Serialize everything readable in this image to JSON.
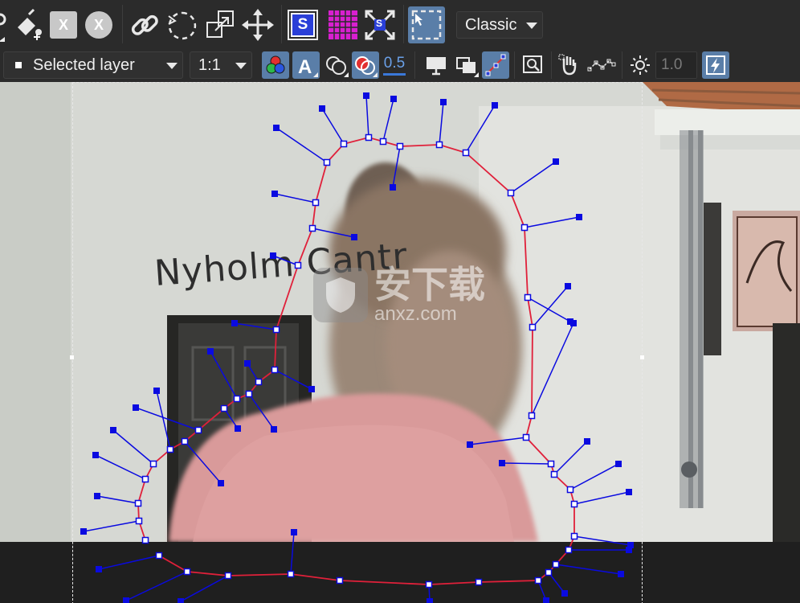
{
  "toolbar1": {
    "mode_dropdown": {
      "value": "Classic"
    },
    "tool_badge_s": "S",
    "fit_badge_s": "S",
    "clear_x1": "X",
    "clear_x2": "X"
  },
  "toolbar2": {
    "layer_dropdown": {
      "value": "Selected layer"
    },
    "zoom_dropdown": {
      "value": "1:1"
    },
    "opacity_value": "0.5",
    "brightness_field": {
      "value": "1.0"
    }
  },
  "canvas": {
    "sign_text": "Nyholm Cantr",
    "watermark": {
      "cn": "安下载",
      "en": "anxz.com"
    }
  },
  "colors": {
    "toolbar_bg": "#2b2b2b",
    "active_button": "#5a7ea8",
    "path_stroke": "#e0203a",
    "handle_color": "#0a0ae0",
    "grid_icon": "#d91fd0"
  }
}
